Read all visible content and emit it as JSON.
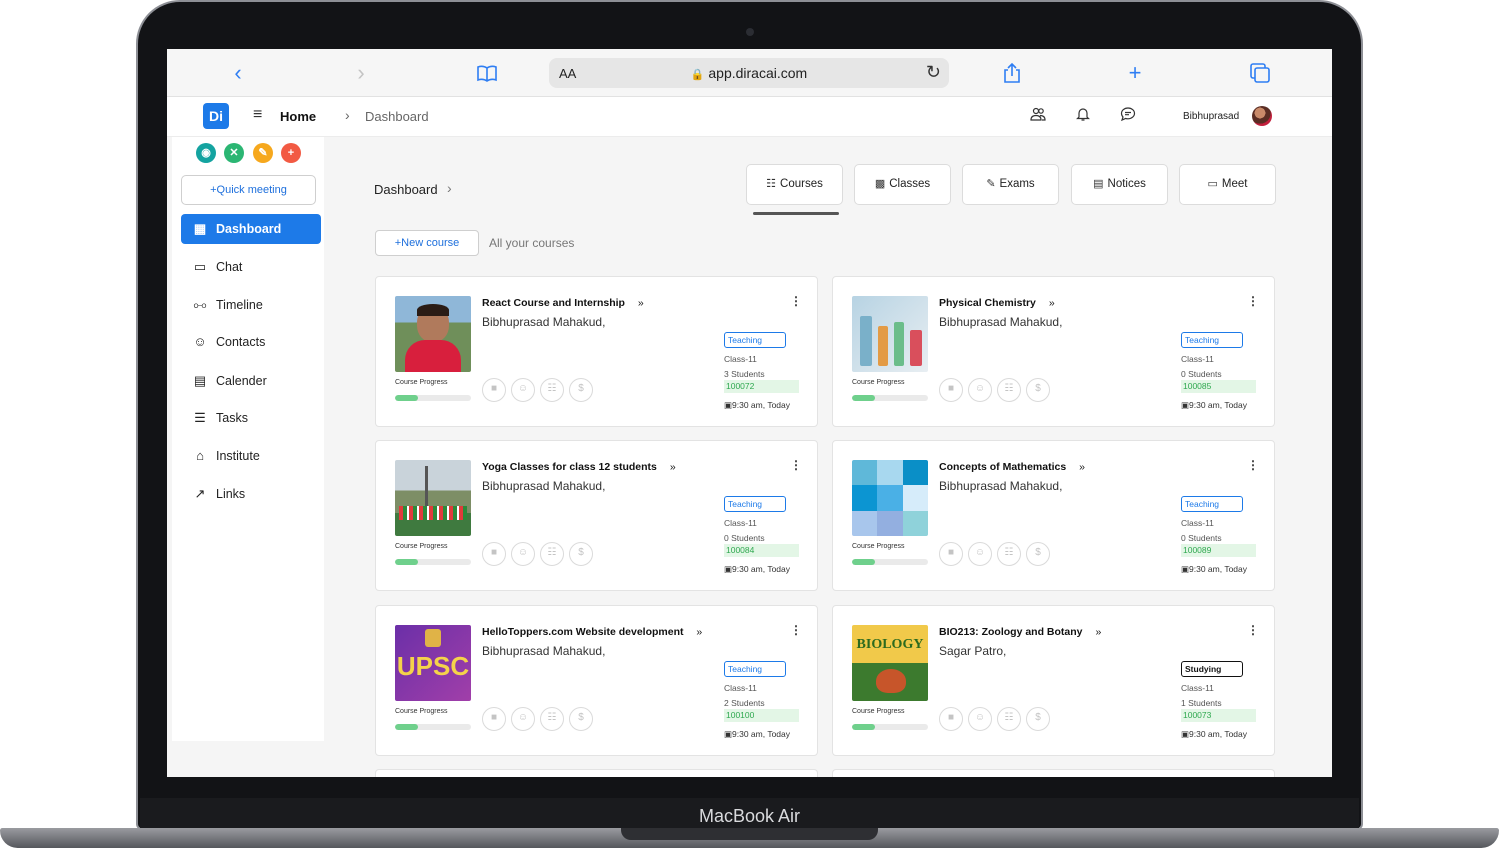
{
  "device": {
    "brand_label": "MacBook Air"
  },
  "browser": {
    "reader_label": "AA",
    "url": "app.diracai.com",
    "back_icon": "chevron-left-icon",
    "forward_icon": "chevron-right-icon",
    "bookmarks_icon": "book-icon",
    "reload_icon": "reload-icon",
    "share_icon": "share-icon",
    "new_tab_icon": "plus-icon",
    "tabs_icon": "tabs-icon"
  },
  "header": {
    "logo_text": "Di",
    "home_label": "Home",
    "breadcrumb_current": "Dashboard",
    "user_name": "Bibhuprasad"
  },
  "sidebar": {
    "quick_meeting_label": "+Quick meeting",
    "items": [
      {
        "label": "Dashboard",
        "icon": "grid-icon",
        "active": true
      },
      {
        "label": "Chat",
        "icon": "chat-icon",
        "active": false
      },
      {
        "label": "Timeline",
        "icon": "timeline-icon",
        "active": false
      },
      {
        "label": "Contacts",
        "icon": "contacts-icon",
        "active": false
      },
      {
        "label": "Calender",
        "icon": "calendar-icon",
        "active": false
      },
      {
        "label": "Tasks",
        "icon": "tasks-icon",
        "active": false
      },
      {
        "label": "Institute",
        "icon": "institute-icon",
        "active": false
      },
      {
        "label": "Links",
        "icon": "link-icon",
        "active": false
      }
    ]
  },
  "main": {
    "title": "Dashboard",
    "tabs": [
      {
        "label": "Courses",
        "icon": "grid-icon"
      },
      {
        "label": "Classes",
        "icon": "classes-icon"
      },
      {
        "label": "Exams",
        "icon": "edit-icon"
      },
      {
        "label": "Notices",
        "icon": "notice-icon"
      },
      {
        "label": "Meet",
        "icon": "video-icon"
      }
    ],
    "new_course_label": "+New course",
    "all_courses_label": "All your courses",
    "progress_label": "Course Progress",
    "courses": [
      {
        "title": "React Course and Internship",
        "author": "Bibhuprasad Mahakud,",
        "badge": "Teaching",
        "class": "Class-11",
        "students": "3 Students",
        "code": "100072",
        "time": "9:30 am, Today",
        "progress": 0.3
      },
      {
        "title": "Physical Chemistry",
        "author": "Bibhuprasad Mahakud,",
        "badge": "Teaching",
        "class": "Class-11",
        "students": "0 Students",
        "code": "100085",
        "time": "9:30 am, Today",
        "progress": 0.3
      },
      {
        "title": "Yoga Classes for class 12 students",
        "author": "Bibhuprasad Mahakud,",
        "badge": "Teaching",
        "class": "Class-11",
        "students": "0 Students",
        "code": "100084",
        "time": "9:30 am, Today",
        "progress": 0.3
      },
      {
        "title": "Concepts of Mathematics",
        "author": "Bibhuprasad Mahakud,",
        "badge": "Teaching",
        "class": "Class-11",
        "students": "0 Students",
        "code": "100089",
        "time": "9:30 am, Today",
        "progress": 0.3
      },
      {
        "title": "HelloToppers.com Website development",
        "author": "Bibhuprasad Mahakud,",
        "badge": "Teaching",
        "class": "Class-11",
        "students": "2 Students",
        "code": "100100",
        "time": "9:30 am, Today",
        "progress": 0.3
      },
      {
        "title": "BIO213: Zoology and Botany",
        "author": "Sagar Patro,",
        "badge": "Studying",
        "class": "Class-11",
        "students": "1 Students",
        "code": "100073",
        "time": "9:30 am, Today",
        "progress": 0.3
      }
    ],
    "thumb_texts": {
      "upsc": "UPSC",
      "biology": "BIOLOGY"
    }
  }
}
